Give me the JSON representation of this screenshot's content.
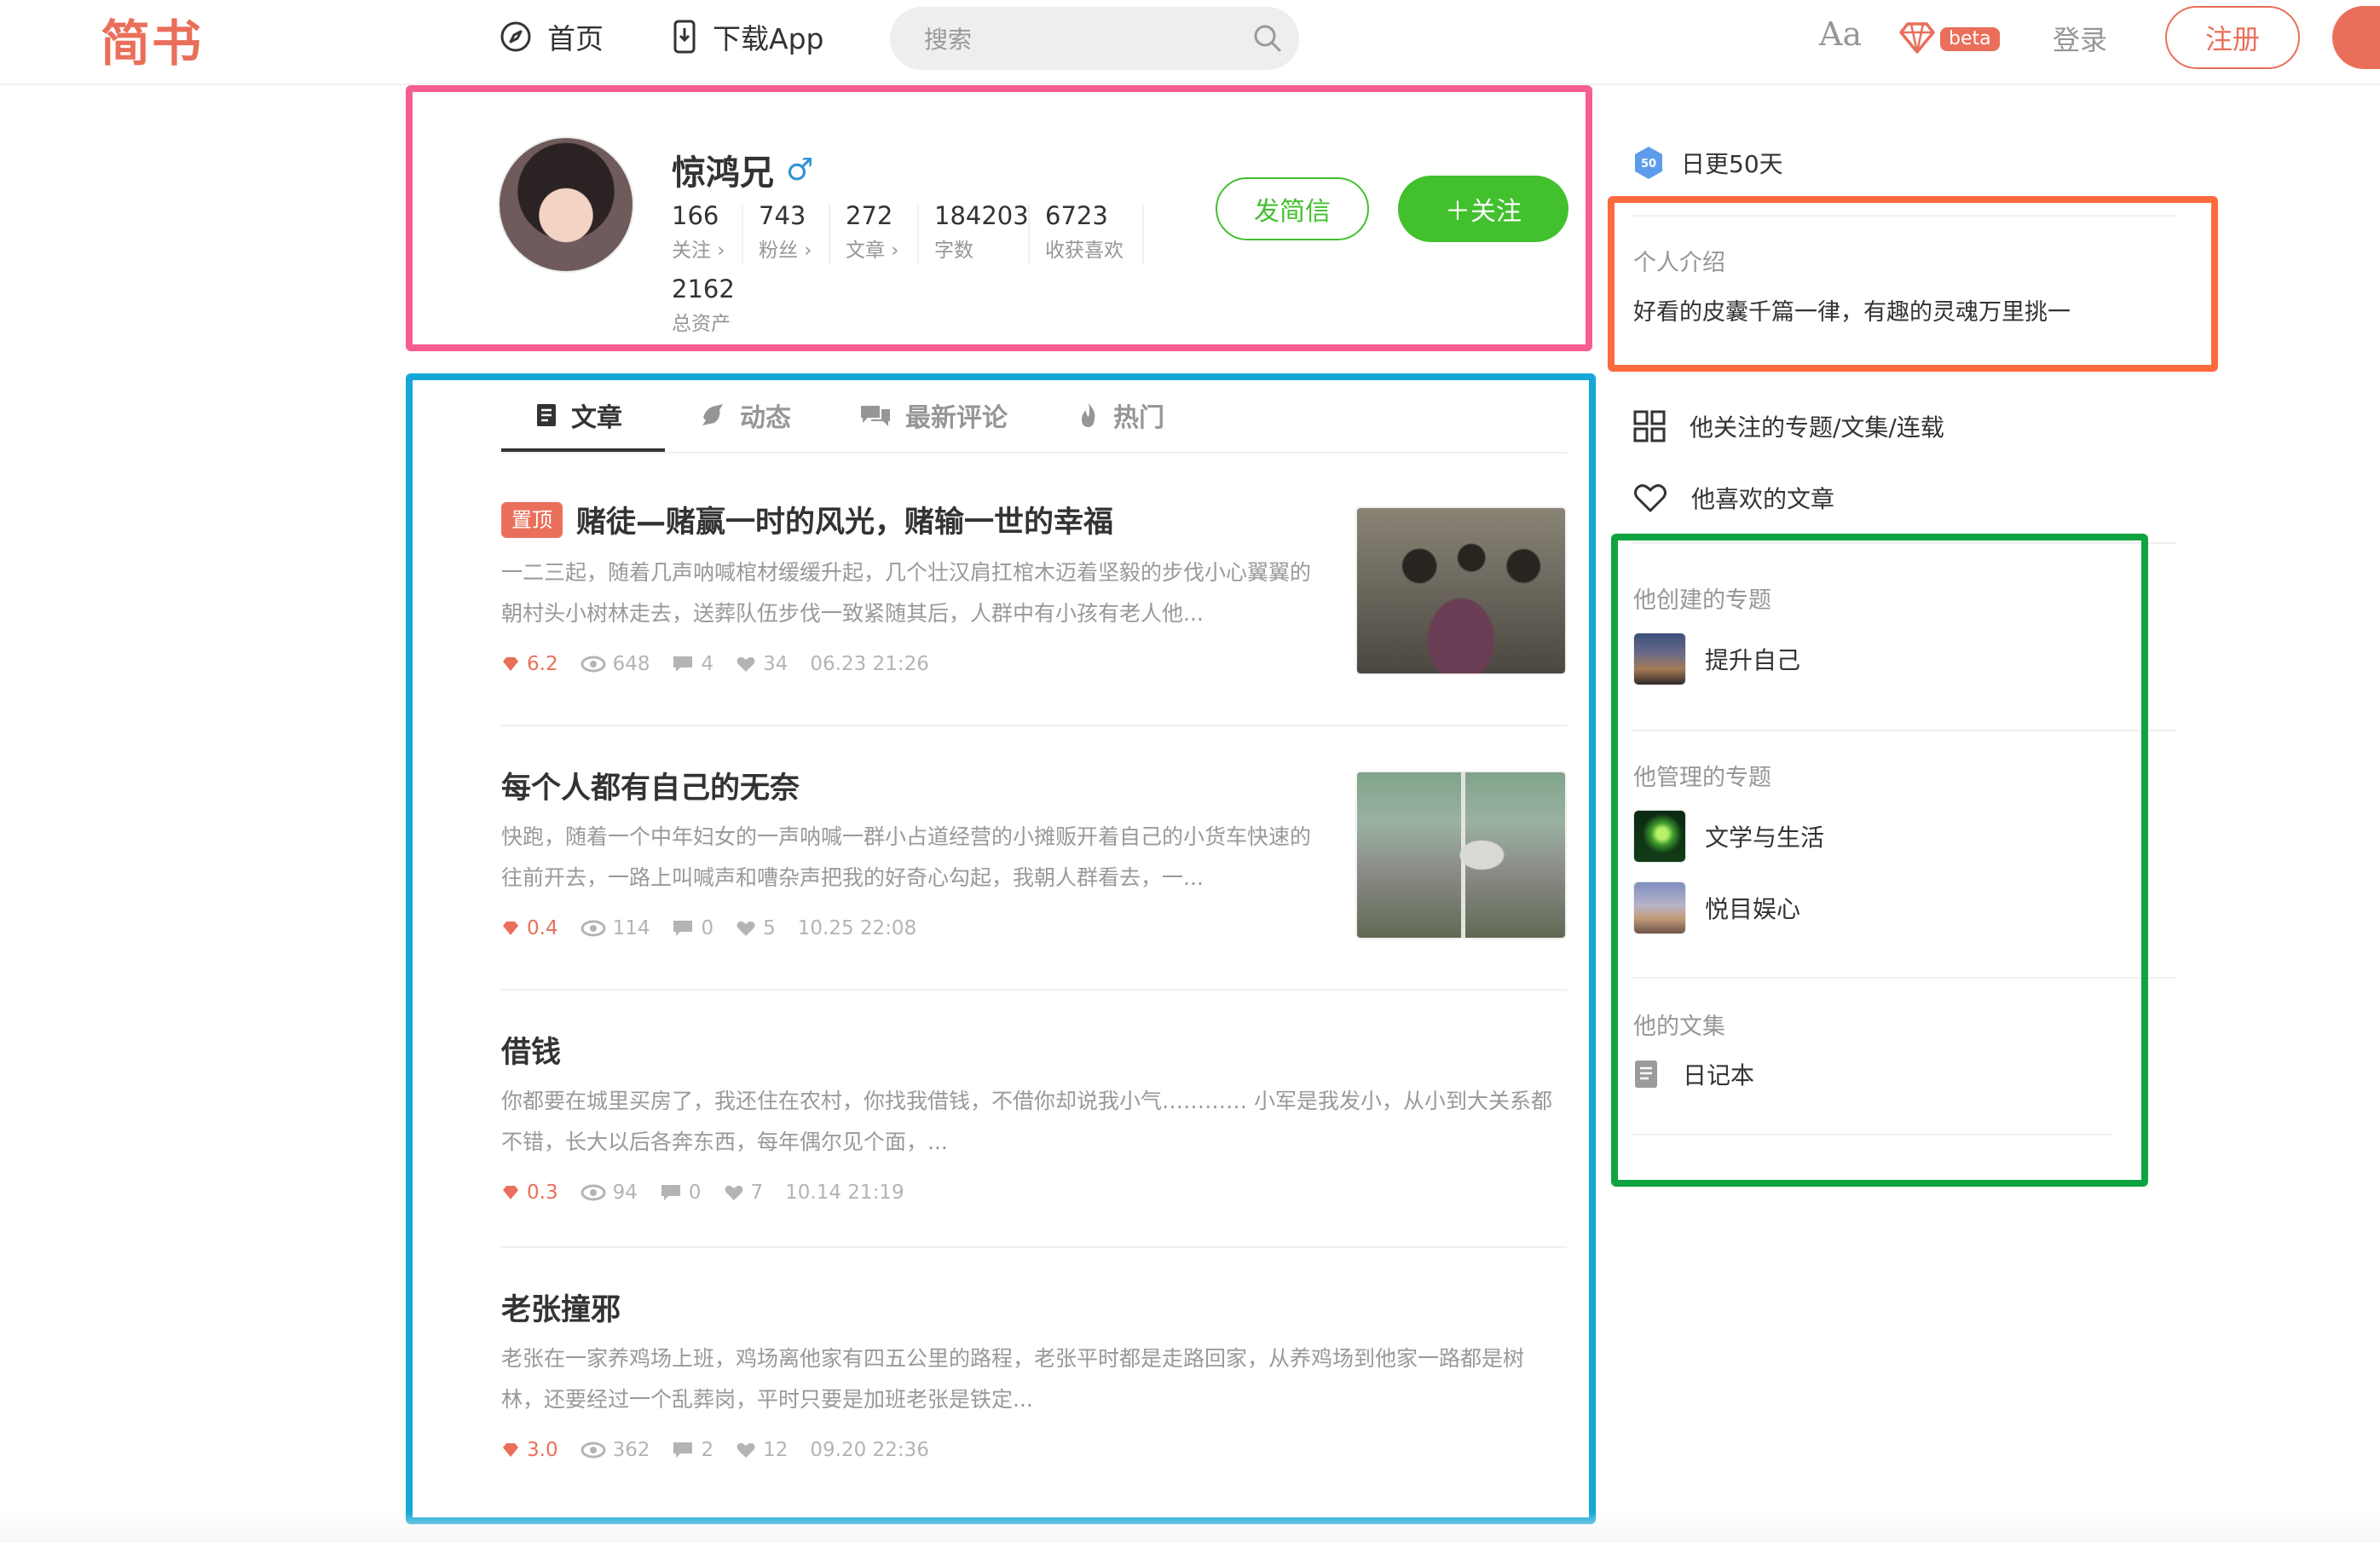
{
  "header": {
    "logo": "简书",
    "nav": [
      {
        "label": "首页",
        "icon": "compass-icon"
      },
      {
        "label": "下载App",
        "icon": "phone-download-icon"
      }
    ],
    "search_placeholder": "搜索",
    "font_toggle": "Aa",
    "beta_label": "beta",
    "login": "登录",
    "register": "注册"
  },
  "profile": {
    "name": "惊鸿兄",
    "gender_symbol": "♂",
    "stats": [
      {
        "num": "166",
        "label": "关注 ›"
      },
      {
        "num": "743",
        "label": "粉丝 ›"
      },
      {
        "num": "272",
        "label": "文章 ›"
      },
      {
        "num": "184203",
        "label": "字数"
      },
      {
        "num": "6723",
        "label": "收获喜欢"
      }
    ],
    "assets": {
      "num": "2162",
      "label": "总资产"
    },
    "message_button": "发简信",
    "follow_button": "＋关注"
  },
  "tabs": [
    {
      "label": "文章",
      "icon": "document-icon",
      "active": true
    },
    {
      "label": "动态",
      "icon": "bell-icon",
      "active": false
    },
    {
      "label": "最新评论",
      "icon": "comments-icon",
      "active": false
    },
    {
      "label": "热门",
      "icon": "flame-icon",
      "active": false
    }
  ],
  "articles": [
    {
      "pinned_label": "置顶",
      "title": "赌徒—赌赢一时的风光，赌输一世的幸福",
      "abstract": "一二三起，随着几声呐喊棺材缓缓升起，几个壮汉肩扛棺木迈着坚毅的步伐小心翼翼的朝村头小树林走去，送葬队伍步伐一致紧随其后，人群中有小孩有老人他...",
      "diamond": "6.2",
      "views": "648",
      "comments": "4",
      "likes": "34",
      "time": "06.23 21:26",
      "has_thumb": true
    },
    {
      "title": "每个人都有自己的无奈",
      "abstract": "快跑，随着一个中年妇女的一声呐喊一群小占道经营的小摊贩开着自己的小货车快速的往前开去，一路上叫喊声和嘈杂声把我的好奇心勾起，我朝人群看去，一...",
      "diamond": "0.4",
      "views": "114",
      "comments": "0",
      "likes": "5",
      "time": "10.25 22:08",
      "has_thumb": true
    },
    {
      "title": "借钱",
      "abstract": "你都要在城里买房了，我还住在农村，你找我借钱，不借你却说我小气………… 小军是我发小，从小到大关系都不错，长大以后各奔东西，每年偶尔见个面，...",
      "diamond": "0.3",
      "views": "94",
      "comments": "0",
      "likes": "7",
      "time": "10.14 21:19",
      "has_thumb": false
    },
    {
      "title": "老张撞邪",
      "abstract": "老张在一家养鸡场上班，鸡场离他家有四五公里的路程，老张平时都是走路回家，从养鸡场到他家一路都是树林，还要经过一个乱葬岗，平时只要是加班老张是铁定...",
      "diamond": "3.0",
      "views": "362",
      "comments": "2",
      "likes": "12",
      "time": "09.20 22:36",
      "has_thumb": false
    }
  ],
  "sidebar": {
    "badge_icon_text": "50",
    "badge_label": "日更50天",
    "intro_title": "个人介绍",
    "intro_text": "好看的皮囊千篇一律，有趣的灵魂万里挑一",
    "links": [
      {
        "label": "他关注的专题/文集/连载",
        "icon": "grid-icon"
      },
      {
        "label": "他喜欢的文章",
        "icon": "heart-icon"
      }
    ],
    "created_title": "他创建的专题",
    "created": [
      {
        "name": "提升自己"
      }
    ],
    "managed_title": "他管理的专题",
    "managed": [
      {
        "name": "文学与生活"
      },
      {
        "name": "悦目娱心"
      }
    ],
    "notebooks_title": "他的文集",
    "notebooks": [
      {
        "name": "日记本",
        "icon": "notebook-icon"
      }
    ]
  },
  "colors": {
    "brand": "#ea6f5a",
    "follow_green": "#42c02e",
    "highlight_pink": "#f65d91",
    "highlight_blue": "#16a7d7",
    "highlight_orange": "#fd6a3d",
    "highlight_green": "#0fa441"
  }
}
